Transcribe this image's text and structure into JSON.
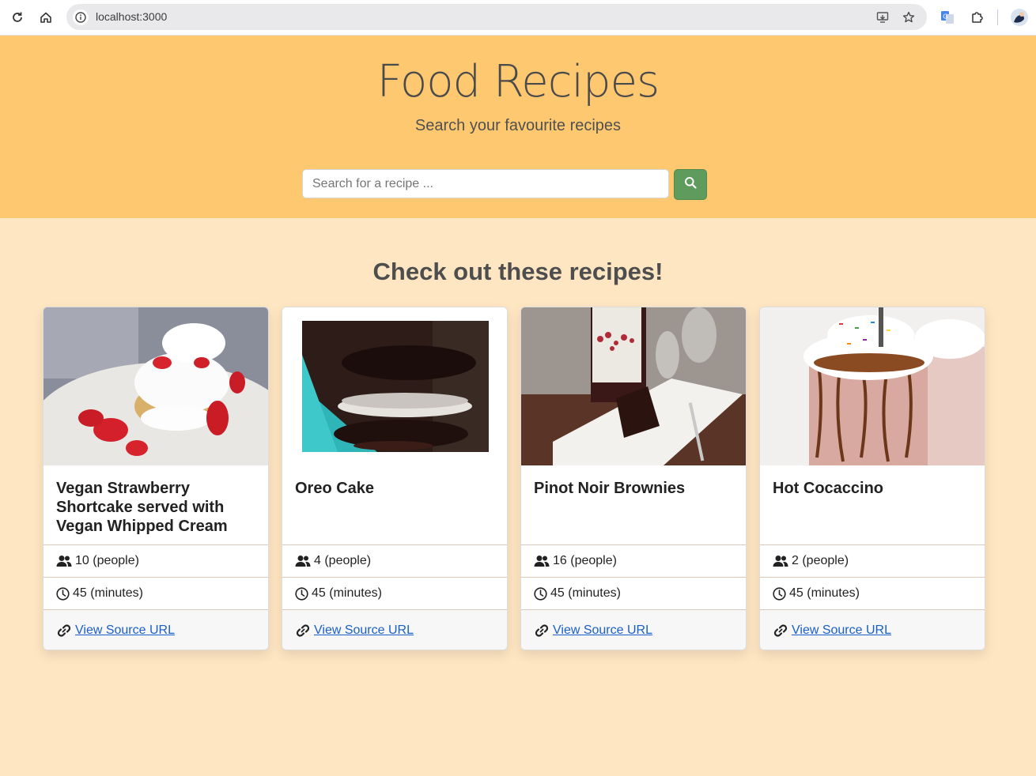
{
  "browser": {
    "url": "localhost:3000"
  },
  "header": {
    "title": "Food Recipes",
    "subtitle": "Search your favourite recipes",
    "search_placeholder": "Search for a recipe ..."
  },
  "section": {
    "title": "Check out these recipes!"
  },
  "colors": {
    "banner": "#fec871",
    "page_bg": "#fee6c3",
    "search_button": "#5f9b5c",
    "link": "#1a5fc9"
  },
  "recipes": [
    {
      "title": "Vegan Strawberry Shortcake served with Vegan Whipped Cream",
      "servings": "10 (people)",
      "time": "45 (minutes)",
      "link_label": "View Source URL",
      "image": "strawberry-shortcake-photo"
    },
    {
      "title": "Oreo Cake",
      "servings": "4 (people)",
      "time": "45 (minutes)",
      "link_label": "View Source URL",
      "image": "oreo-cake-photo"
    },
    {
      "title": "Pinot Noir Brownies",
      "servings": "16 (people)",
      "time": "45 (minutes)",
      "link_label": "View Source URL",
      "image": "pinot-noir-brownies-photo"
    },
    {
      "title": "Hot Cocaccino",
      "servings": "2 (people)",
      "time": "45 (minutes)",
      "link_label": "View Source URL",
      "image": "hot-cocaccino-photo"
    }
  ]
}
